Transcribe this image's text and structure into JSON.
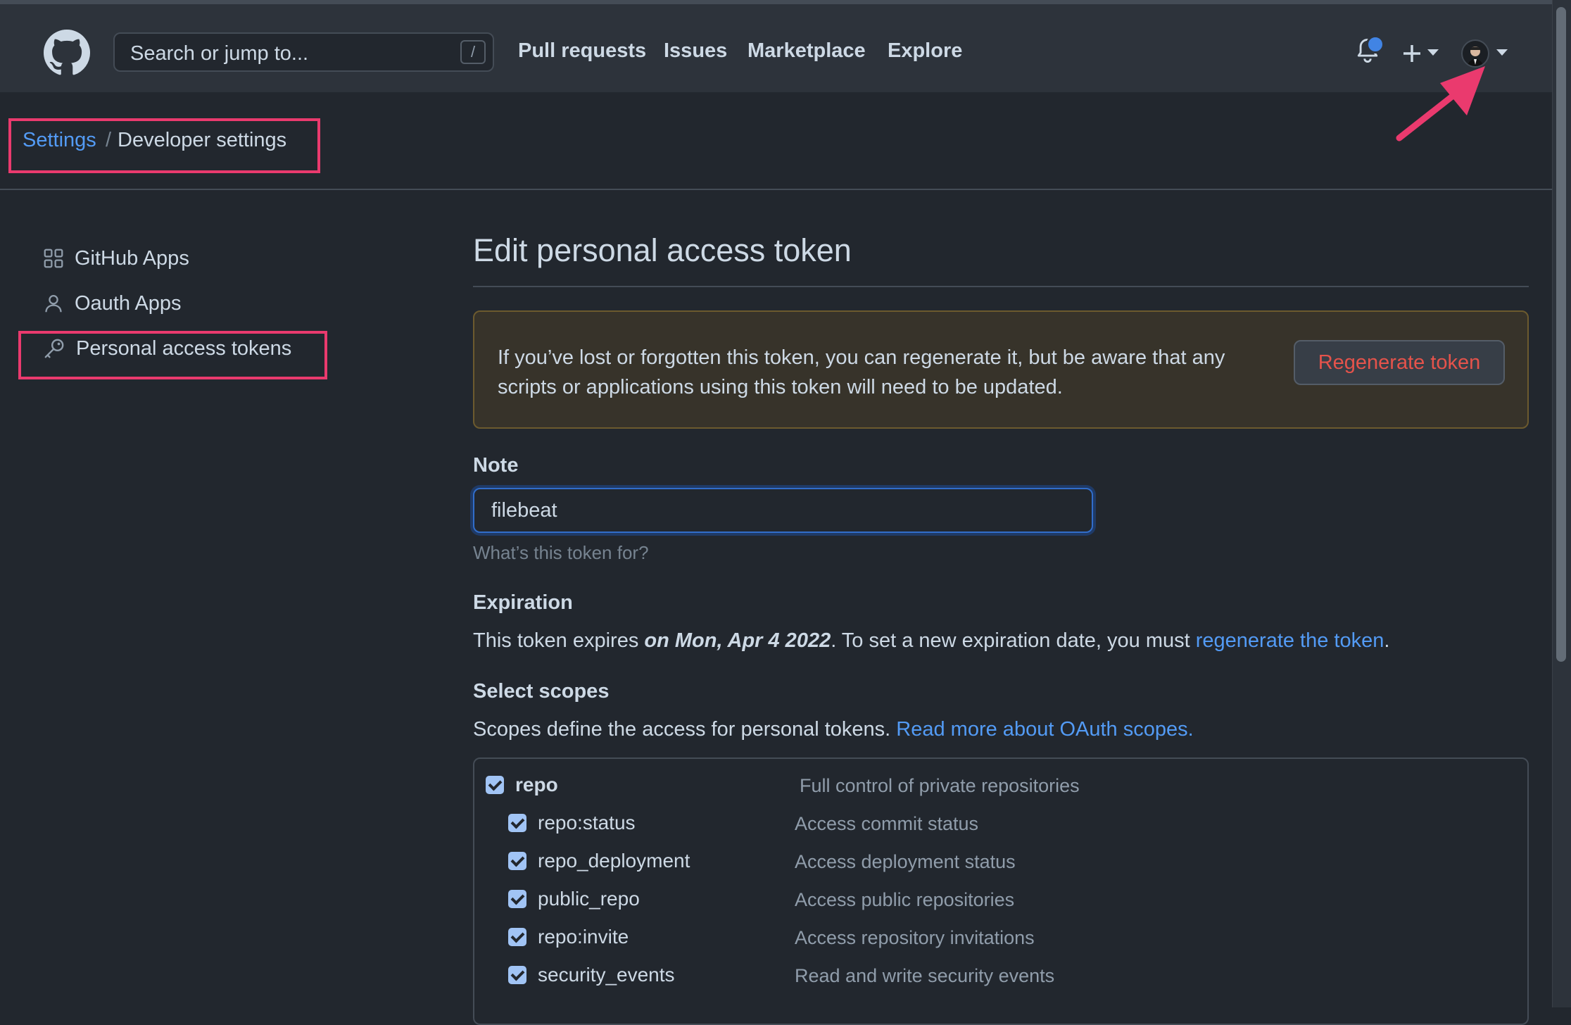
{
  "header": {
    "logo_icon": "github-octocat-icon",
    "search_placeholder": "Search or jump to...",
    "search_shortcut": "/",
    "nav": [
      "Pull requests",
      "Issues",
      "Marketplace",
      "Explore"
    ],
    "icons": [
      "bell-icon",
      "plus-icon",
      "chevron-down-icon",
      "avatar"
    ]
  },
  "breadcrumb": {
    "root": "Settings",
    "separator": "/",
    "current": "Developer settings"
  },
  "sidebar": {
    "items": [
      {
        "label": "GitHub Apps",
        "icon": "apps-grid-icon"
      },
      {
        "label": "Oauth Apps",
        "icon": "person-icon"
      },
      {
        "label": "Personal access tokens",
        "icon": "key-icon"
      }
    ]
  },
  "main": {
    "title": "Edit personal access token",
    "warning": {
      "text": "If you’ve lost or forgotten this token, you can regenerate it, but be aware that any scripts or applications using this token will need to be updated.",
      "button": "Regenerate token"
    },
    "note": {
      "label": "Note",
      "value": "filebeat",
      "hint": "What’s this token for?"
    },
    "expiration": {
      "label": "Expiration",
      "prefix": "This token expires ",
      "date": "on Mon, Apr 4 2022",
      "middle": ". To set a new expiration date, you must ",
      "link": "regenerate the token",
      "suffix": "."
    },
    "scopes": {
      "label": "Select scopes",
      "description": "Scopes define the access for personal tokens. ",
      "link": "Read more about OAuth scopes.",
      "items": [
        {
          "name": "repo",
          "desc": "Full control of private repositories",
          "checked": true,
          "parent": true
        },
        {
          "name": "repo:status",
          "desc": "Access commit status",
          "checked": true
        },
        {
          "name": "repo_deployment",
          "desc": "Access deployment status",
          "checked": true
        },
        {
          "name": "public_repo",
          "desc": "Access public repositories",
          "checked": true
        },
        {
          "name": "repo:invite",
          "desc": "Access repository invitations",
          "checked": true
        },
        {
          "name": "security_events",
          "desc": "Read and write security events",
          "checked": true
        }
      ]
    }
  },
  "colors": {
    "annotation": "#ea3a6e",
    "link": "#539bf5",
    "danger": "#e5534b"
  }
}
